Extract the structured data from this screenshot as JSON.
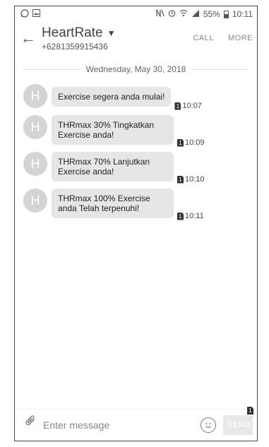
{
  "status_bar": {
    "left_icons": [
      "whatsapp-icon",
      "image-icon"
    ],
    "right_icons": [
      "nfc-icon",
      "alarm-icon",
      "wifi-icon",
      "signal-icon"
    ],
    "battery": "55%",
    "time": "10:11"
  },
  "header": {
    "back_icon": "←",
    "contact_name": "HeartRate",
    "dropdown_icon": "▼",
    "contact_number": "+6281359915436",
    "call_label": "CALL",
    "more_label": "MORE"
  },
  "conversation": {
    "date": "Wednesday, May 30, 2018",
    "messages": [
      {
        "avatar": "H",
        "text": "Exercise segera anda mulai!",
        "sim": "1",
        "time": "10:07"
      },
      {
        "avatar": "H",
        "text": "THRmax 30% Tingkatkan Exercise anda!",
        "sim": "1",
        "time": "10:09"
      },
      {
        "avatar": "H",
        "text": "THRmax 70% Lanjutkan Exercise anda!",
        "sim": "1",
        "time": "10:10"
      },
      {
        "avatar": "H",
        "text": "THRmax 100% Exercise anda Telah terpenuhi!",
        "sim": "1",
        "time": "10:11"
      }
    ]
  },
  "composer": {
    "attach_icon": "paperclip-icon",
    "placeholder": "Enter message",
    "emoji_icon": "smiley-icon",
    "send_label": "SEND",
    "send_sim": "1"
  }
}
